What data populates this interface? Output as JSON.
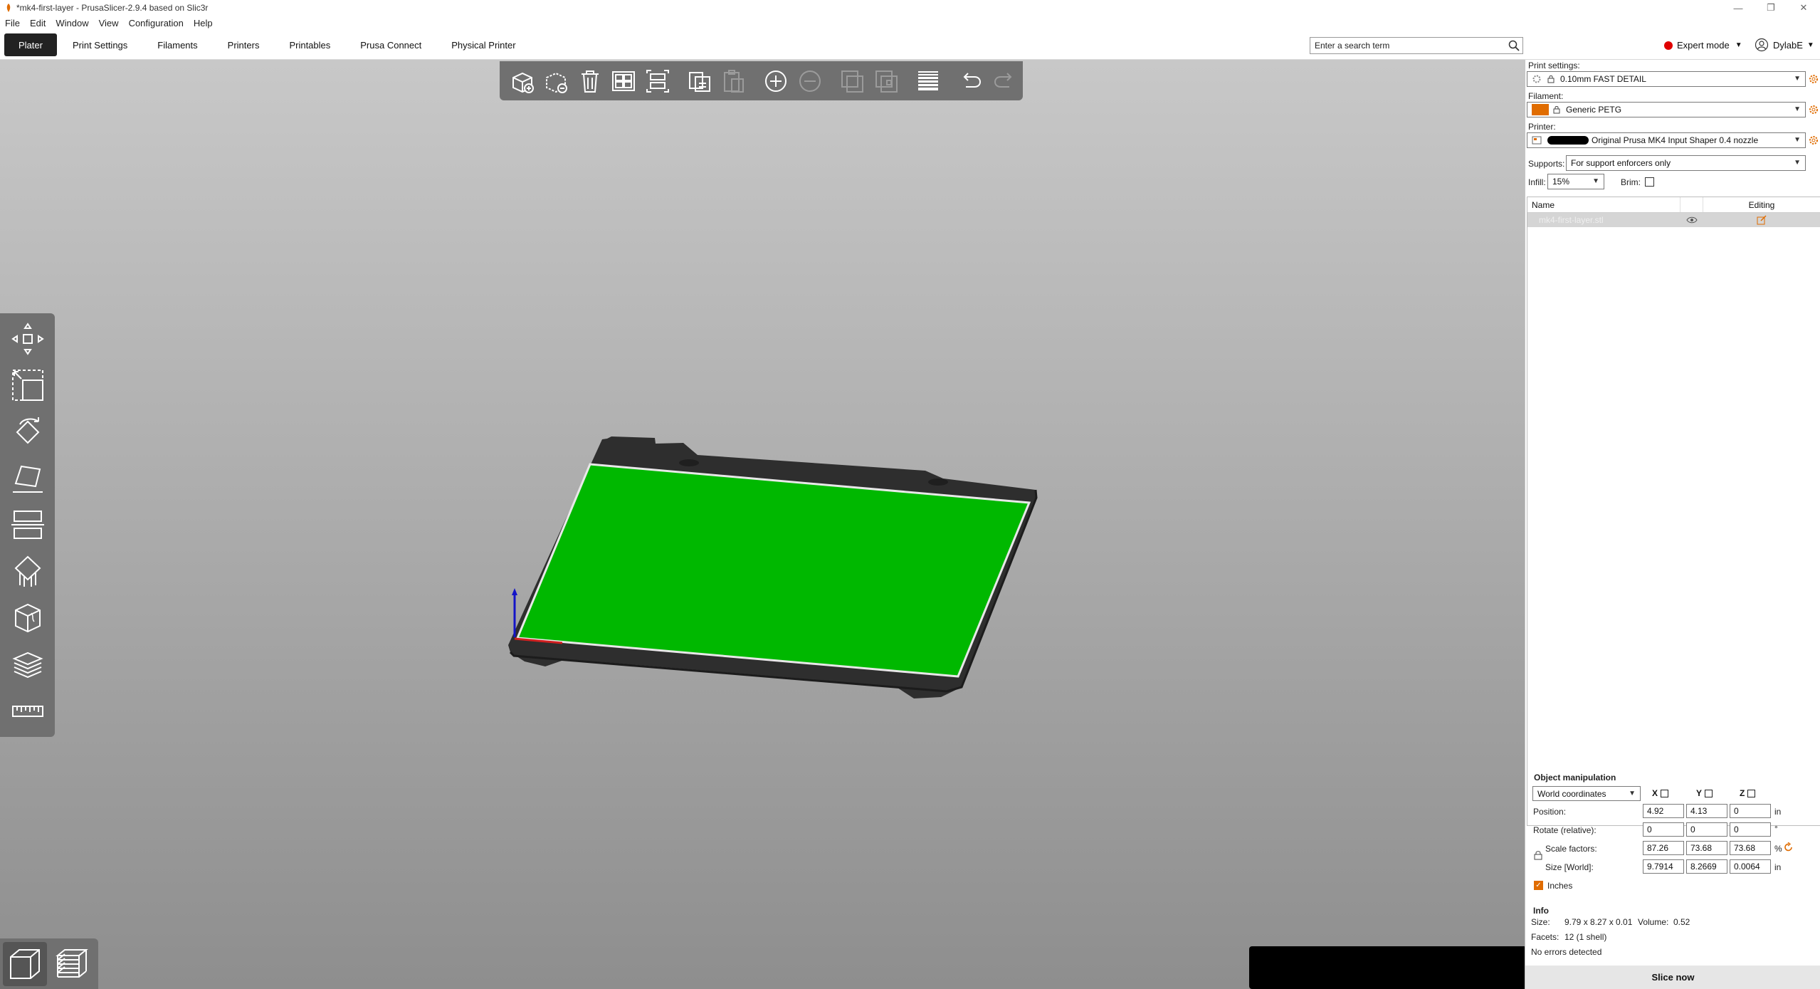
{
  "window": {
    "title": "*mk4-first-layer - PrusaSlicer-2.9.4 based on Slic3r",
    "controls": [
      "—",
      "❐",
      "✕"
    ]
  },
  "menu": [
    "File",
    "Edit",
    "Window",
    "View",
    "Configuration",
    "Help"
  ],
  "tabs": [
    "Plater",
    "Print Settings",
    "Filaments",
    "Printers",
    "Printables",
    "Prusa Connect",
    "Physical Printer"
  ],
  "search": {
    "placeholder": "Enter a search term"
  },
  "mode": {
    "label": "Expert mode",
    "color": "#e00000"
  },
  "user": {
    "name": "DylabE"
  },
  "colors": {
    "accent": "#e06c00",
    "bed_surface": "#00b800",
    "toolbar_bg": "#707070"
  },
  "sidebar": {
    "print_settings": {
      "label": "Print settings:",
      "value": "0.10mm FAST DETAIL"
    },
    "filament": {
      "label": "Filament:",
      "value": "Generic PETG"
    },
    "printer": {
      "label": "Printer:",
      "value": "Original Prusa MK4 Input Shaper 0.4 nozzle"
    },
    "supports": {
      "label": "Supports:",
      "value": "For support enforcers only"
    },
    "infill": {
      "label": "Infill:",
      "value": "15%"
    },
    "brim": {
      "label": "Brim:",
      "checked": false
    },
    "object_list": {
      "headers": {
        "name": "Name",
        "editing": "Editing"
      },
      "items": [
        {
          "name": "mk4-first-layer.stl"
        }
      ]
    },
    "object_manipulation": {
      "title": "Object manipulation",
      "coord_system": "World coordinates",
      "axes": [
        "X",
        "Y",
        "Z"
      ],
      "position": {
        "label": "Position:",
        "x": "4.92",
        "y": "4.13",
        "z": "0",
        "unit": "in"
      },
      "rotate": {
        "label": "Rotate (relative):",
        "x": "0",
        "y": "0",
        "z": "0",
        "unit": "°"
      },
      "scale": {
        "label": "Scale factors:",
        "x": "87.26",
        "y": "73.68",
        "z": "73.68",
        "unit": "%"
      },
      "size": {
        "label": "Size [World]:",
        "x": "9.7914",
        "y": "8.2669",
        "z": "0.0064",
        "unit": "in"
      },
      "inches": {
        "label": "Inches",
        "checked": true
      }
    },
    "info": {
      "title": "Info",
      "size_label": "Size:",
      "size": "9.79 x 8.27 x 0.01",
      "volume_label": "Volume:",
      "volume": "0.52",
      "facets_label": "Facets:",
      "facets": "12 (1 shell)",
      "errors": "No errors detected"
    },
    "slice_button": "Slice now"
  }
}
